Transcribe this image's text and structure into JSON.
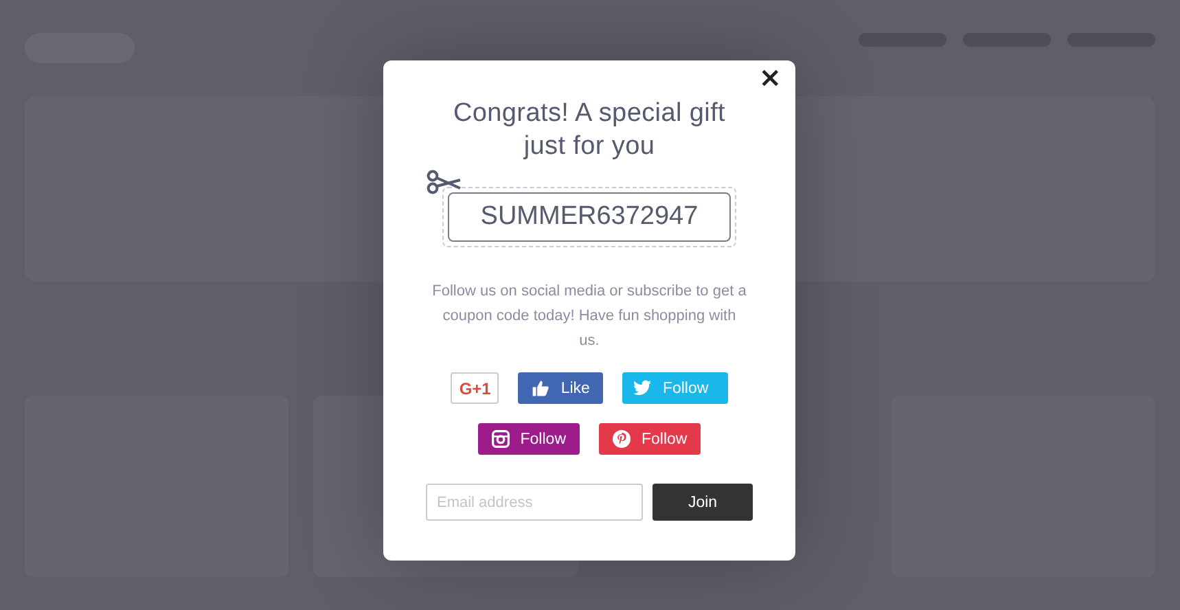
{
  "dialog": {
    "title": "Congrats! A special gift just for you",
    "close": "×",
    "coupon_code": "SUMMER6372947",
    "message": "Follow us on social media or subscribe to get a coupon code today! Have fun shopping with us.",
    "social_rows": [
      [
        {
          "kind": "google",
          "label": "G+1",
          "color": "#ffffff"
        },
        {
          "kind": "facebook",
          "label": "Like",
          "color": "#4267b2"
        },
        {
          "kind": "twitter",
          "label": "Follow",
          "color": "#1ab7ea"
        }
      ],
      [
        {
          "kind": "instagram",
          "label": "Follow",
          "color": "#9c1c8c"
        },
        {
          "kind": "pinterest",
          "label": "Follow",
          "color": "#e3394a"
        }
      ]
    ],
    "email": {
      "placeholder": "Email address"
    },
    "submit": "Join"
  }
}
